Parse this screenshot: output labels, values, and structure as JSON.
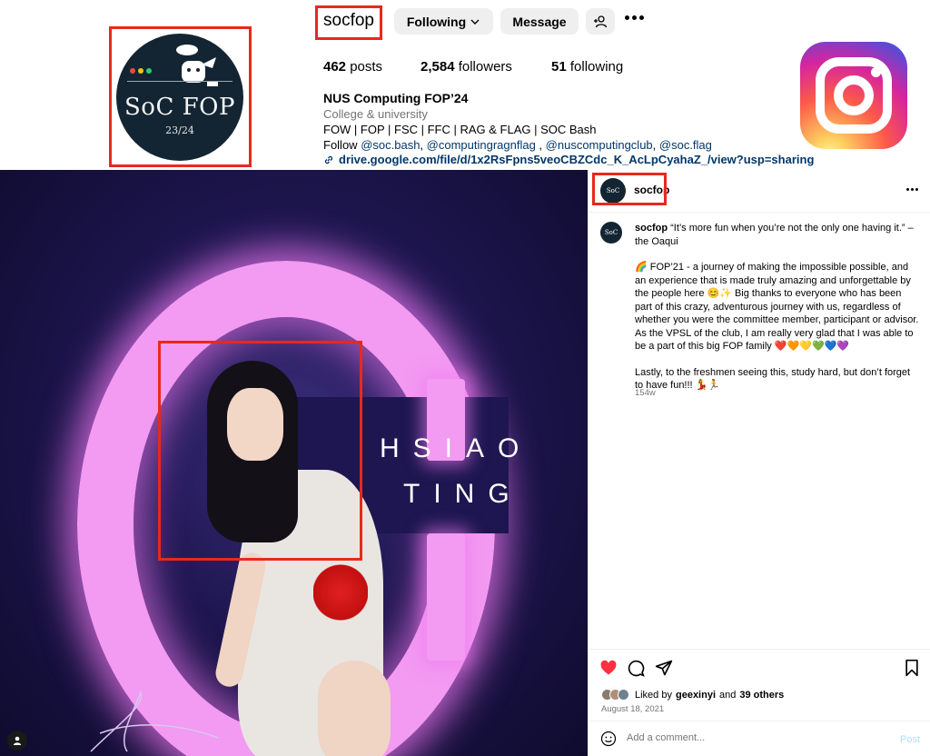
{
  "profile": {
    "username": "socfop",
    "avatar": {
      "title": "SoC FOP",
      "subtitle": "23/24"
    },
    "buttons": {
      "following": "Following",
      "message": "Message"
    },
    "stats": [
      {
        "count": "462",
        "label": "posts"
      },
      {
        "count": "2,584",
        "label": "followers"
      },
      {
        "count": "51",
        "label": "following"
      }
    ],
    "bio": {
      "name": "NUS Computing FOP’24",
      "category": "College & university",
      "line": "FOW | FOP | FSC | FFC | RAG & FLAG | SOC Bash",
      "follow_prefix": "Follow",
      "mentions": [
        "@soc.bash",
        "@computingragnflag",
        "@nuscomputingclub",
        "@soc.flag"
      ],
      "link": "drive.google.com/file/d/1x2RsFpns5veoCBZCdc_K_AcLpCyahaZ_/view?usp=sharing"
    }
  },
  "post": {
    "image_text": {
      "line1": "HSIAO",
      "line2": "TING"
    },
    "header_user": "socfop",
    "caption": {
      "user": "socfop",
      "quote": "“It’s more fun when you’re not the only one having it.” – the Oaqui",
      "para1": "🌈 FOP’21 - a journey of making the impossible possible, and an experience that is made truly amazing and unforgettable by the people here 😊✨ Big thanks to everyone who has been part of this crazy, adventurous journey with us, regardless of whether you were the committee member, participant or advisor. As the VPSL of the club, I am really very glad that I was able to be a part of this big FOP family ❤️🧡💛💚💙💜",
      "para2": "Lastly, to the freshmen seeing this, study hard, but don’t forget to have fun!!! 💃🏃",
      "time": "154w"
    },
    "likes": {
      "prefix": "Liked by",
      "user": "geexinyi",
      "and": "and",
      "others": "39 others"
    },
    "date": "August 18, 2021",
    "comment_placeholder": "Add a comment...",
    "post_button": "Post"
  },
  "colors": {
    "highlight": "#e8291c",
    "link": "#00376b",
    "like_red": "#ff3040",
    "post_disabled": "#b2dffc"
  }
}
